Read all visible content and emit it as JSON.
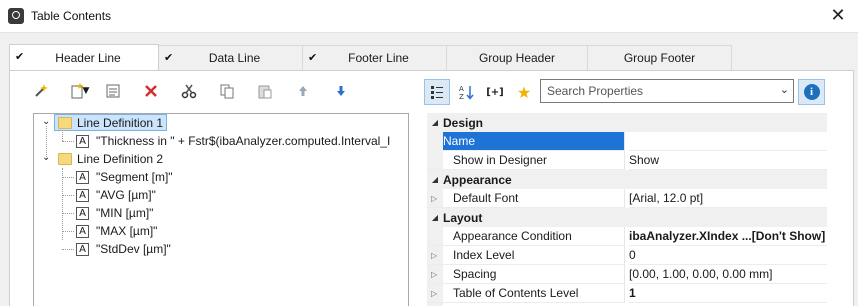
{
  "window": {
    "title": "Table Contents",
    "close_glyph": "✕"
  },
  "tabs": [
    {
      "label": "Header Line",
      "checked": true,
      "active": true
    },
    {
      "label": "Data Line",
      "checked": true,
      "active": false
    },
    {
      "label": "Footer Line",
      "checked": true,
      "active": false
    },
    {
      "label": "Group Header",
      "checked": false,
      "active": false
    },
    {
      "label": "Group Footer",
      "checked": false,
      "active": false
    }
  ],
  "left_toolbar": {
    "icons": [
      "wand-icon",
      "new-item-icon",
      "properties-icon",
      "delete-icon",
      "cut-icon",
      "copy-icon",
      "paste-icon",
      "move-up-icon",
      "move-down-icon"
    ]
  },
  "tree": {
    "nodes": [
      {
        "label": "Line Definition  1",
        "type": "folder",
        "selected": true
      },
      {
        "label": "\"Thickness in \" + Fstr$(ibaAnalyzer.computed.Interval_I",
        "type": "text"
      },
      {
        "label": "Line Definition  2",
        "type": "folder",
        "selected": false
      },
      {
        "label": "\"Segment [m]\"",
        "type": "text"
      },
      {
        "label": "\"AVG [µm]\"",
        "type": "text"
      },
      {
        "label": "\"MIN [µm]\"",
        "type": "text"
      },
      {
        "label": "\"MAX [µm]\"",
        "type": "text"
      },
      {
        "label": "\"StdDev [µm]\"",
        "type": "text"
      }
    ],
    "text_icon_glyph": "A"
  },
  "right_toolbar": {
    "categorized_icon": "categorized-icon",
    "alphabetical_icon": "sort-az-icon",
    "expression_label": "[+]",
    "favorite_icon": "star-icon",
    "search_placeholder": "Search Properties",
    "info_label": "i"
  },
  "properties": {
    "design_label": "Design",
    "name_label": "Name",
    "name_value": "",
    "show_in_designer_label": "Show in Designer",
    "show_in_designer_value": "Show",
    "appearance_label": "Appearance",
    "default_font_label": "Default Font",
    "default_font_value": "[Arial, 12.0 pt]",
    "layout_label": "Layout",
    "appearance_condition_label": "Appearance Condition",
    "appearance_condition_value": "ibaAnalyzer.XIndex ...[Don't Show]",
    "index_level_label": "Index Level",
    "index_level_value": "0",
    "spacing_label": "Spacing",
    "spacing_value": "[0.00, 1.00, 0.00, 0.00 mm]",
    "toc_level_label": "Table of Contents Level",
    "toc_level_value": "1"
  },
  "colors": {
    "selection": "#1e74d6",
    "tree_selection": "#cce4fb",
    "folder": "#f6d97b",
    "delete": "#d32f2f"
  }
}
